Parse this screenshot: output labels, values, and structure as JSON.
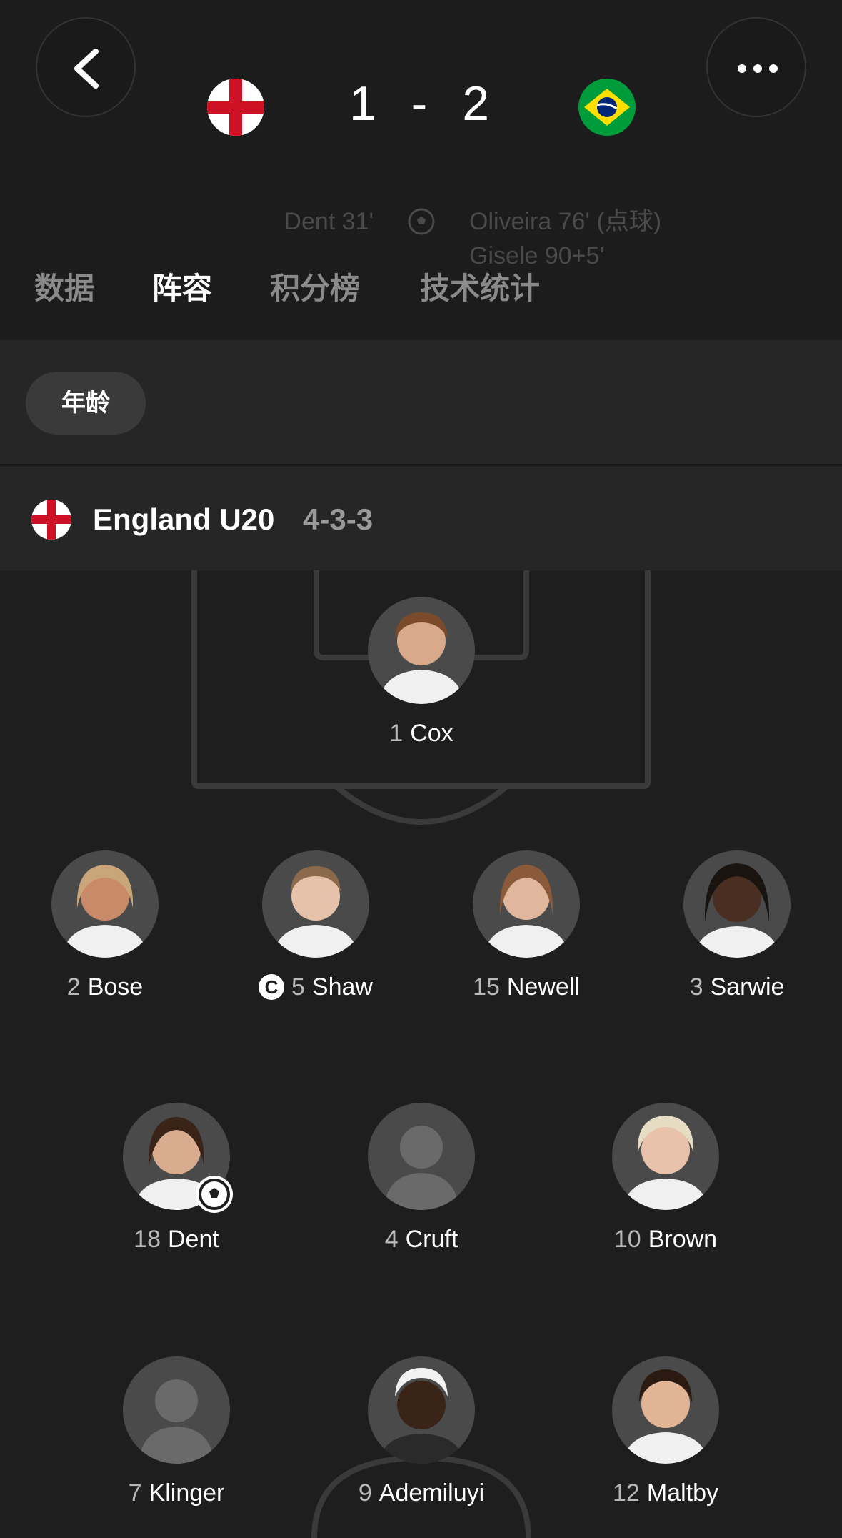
{
  "match": {
    "home_score": "1",
    "separator": "-",
    "away_score": "2",
    "home_scorers": [
      "Dent 31'"
    ],
    "away_scorers": [
      "Oliveira 76' (点球)",
      "Gisele 90+5'"
    ]
  },
  "tabs": [
    {
      "label": "数据",
      "active": false
    },
    {
      "label": "阵容",
      "active": true
    },
    {
      "label": "积分榜",
      "active": false
    },
    {
      "label": "技术统计",
      "active": false
    }
  ],
  "filter": {
    "chip_label": "年龄"
  },
  "team": {
    "name": "England U20",
    "formation": "4-3-3"
  },
  "players": [
    {
      "number": "1",
      "name": "Cox",
      "captain": false,
      "goal": false,
      "photo": true
    },
    {
      "number": "2",
      "name": "Bose",
      "captain": false,
      "goal": false,
      "photo": true
    },
    {
      "number": "5",
      "name": "Shaw",
      "captain": true,
      "goal": false,
      "photo": true
    },
    {
      "number": "15",
      "name": "Newell",
      "captain": false,
      "goal": false,
      "photo": true
    },
    {
      "number": "3",
      "name": "Sarwie",
      "captain": false,
      "goal": false,
      "photo": true
    },
    {
      "number": "18",
      "name": "Dent",
      "captain": false,
      "goal": true,
      "photo": true
    },
    {
      "number": "4",
      "name": "Cruft",
      "captain": false,
      "goal": false,
      "photo": false
    },
    {
      "number": "10",
      "name": "Brown",
      "captain": false,
      "goal": false,
      "photo": true
    },
    {
      "number": "7",
      "name": "Klinger",
      "captain": false,
      "goal": false,
      "photo": false
    },
    {
      "number": "9",
      "name": "Ademiluyi",
      "captain": false,
      "goal": false,
      "photo": true
    },
    {
      "number": "12",
      "name": "Maltby",
      "captain": false,
      "goal": false,
      "photo": true
    }
  ],
  "captain_mark": "C",
  "icons": {
    "back": "chevron-left-icon",
    "more": "ellipsis-icon",
    "goal": "soccer-ball-icon",
    "captain": "captain-badge-icon"
  },
  "colors": {
    "background": "#1e1e1e",
    "panel": "#262626",
    "england_red": "#ce1124",
    "brazil_green": "#009c3b",
    "brazil_yellow": "#ffdf00",
    "brazil_blue": "#002776"
  }
}
